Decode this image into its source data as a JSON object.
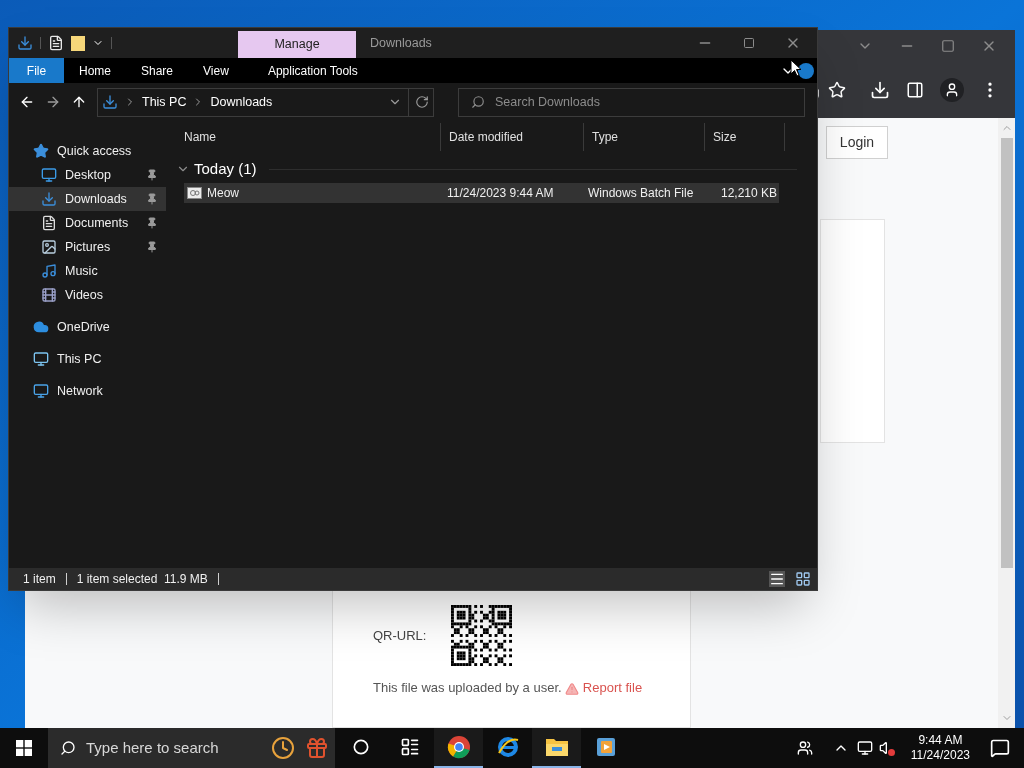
{
  "browser": {
    "login": "Login",
    "qr_label": "QR-URL:",
    "note": "This file was uploaded by a user.",
    "report": "Report file"
  },
  "explorer": {
    "title": "Downloads",
    "context_tab": "Manage",
    "ribbon_tabs": [
      {
        "label": "File",
        "kind": "file"
      },
      {
        "label": "Home",
        "kind": "tab"
      },
      {
        "label": "Share",
        "kind": "tab"
      },
      {
        "label": "View",
        "kind": "tab"
      },
      {
        "label": "Application Tools",
        "kind": "context"
      }
    ],
    "address": [
      "This PC",
      "Downloads"
    ],
    "search": {
      "placeholder": "Search Downloads"
    },
    "navigation": [
      {
        "label": "Quick access",
        "kind": "star",
        "selected": false,
        "children": [
          {
            "label": "Desktop",
            "kind": "desktop",
            "pinned": true,
            "selected": false
          },
          {
            "label": "Downloads",
            "kind": "download",
            "pinned": true,
            "selected": true
          },
          {
            "label": "Documents",
            "kind": "document",
            "pinned": true,
            "selected": false
          },
          {
            "label": "Pictures",
            "kind": "picture",
            "pinned": true,
            "selected": false
          },
          {
            "label": "Music",
            "kind": "music",
            "pinned": false,
            "selected": false
          },
          {
            "label": "Videos",
            "kind": "video",
            "pinned": false,
            "selected": false
          }
        ]
      },
      {
        "label": "OneDrive",
        "kind": "cloud",
        "selected": false
      },
      {
        "label": "This PC",
        "kind": "pc",
        "selected": false
      },
      {
        "label": "Network",
        "kind": "network",
        "selected": false
      }
    ],
    "columns": [
      "Name",
      "Date modified",
      "Type",
      "Size"
    ],
    "groups": [
      {
        "label": "Today (1)",
        "expanded": true,
        "rows": [
          {
            "name": "Meow",
            "date": "11/24/2023 9:44 AM",
            "type": "Windows Batch File",
            "size": "12,210 KB",
            "selected": true
          }
        ]
      }
    ],
    "status": [
      "1 item",
      "1 item selected  11.9 MB"
    ]
  },
  "taskbar": {
    "search_placeholder": "Type here to search",
    "apps": [
      {
        "kind": "cortana",
        "running": false
      },
      {
        "kind": "taskview",
        "running": false
      },
      {
        "kind": "chrome",
        "running": true
      },
      {
        "kind": "ie",
        "running": false
      },
      {
        "kind": "explorer",
        "running": true
      },
      {
        "kind": "media",
        "running": false
      }
    ],
    "volume_muted": true,
    "time": "9:44 AM",
    "date": "11/24/2023"
  }
}
